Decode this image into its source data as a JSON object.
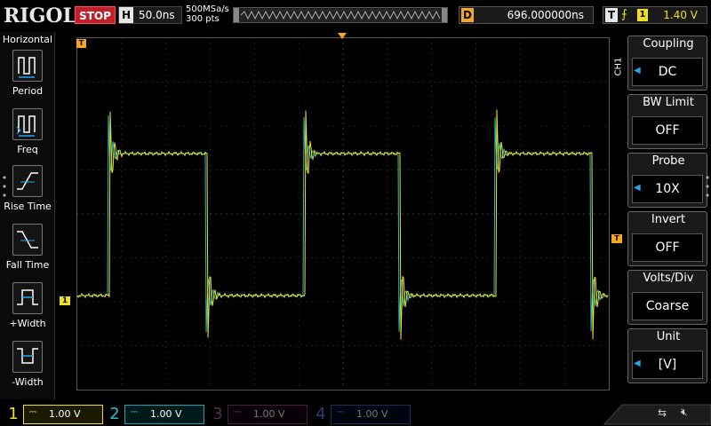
{
  "top": {
    "logo": "RIGOL",
    "run_state": "STOP",
    "h_label": "H",
    "timebase": "50.0ns",
    "sample_rate": "500MSa/s",
    "mem_depth": "300 pts",
    "delay_label": "D",
    "delay_value": "696.000000ns",
    "trig_label": "T",
    "trig_edge": "⨍",
    "trig_source": "1",
    "trig_level": "1.40 V"
  },
  "left": {
    "title": "Horizontal",
    "items": [
      {
        "label": "Period"
      },
      {
        "label": "Freq"
      },
      {
        "label": "Rise Time"
      },
      {
        "label": "Fall Time"
      },
      {
        "label": "+Width"
      },
      {
        "label": "-Width"
      }
    ]
  },
  "right": {
    "channel_tag": "CH1",
    "menu": [
      {
        "title": "Coupling",
        "value": "DC"
      },
      {
        "title": "BW Limit",
        "value": "OFF"
      },
      {
        "title": "Probe",
        "value": "10X"
      },
      {
        "title": "Invert",
        "value": "OFF"
      },
      {
        "title": "Volts/Div",
        "value": "Coarse"
      },
      {
        "title": "Unit",
        "value": "[V]"
      }
    ]
  },
  "channels": [
    {
      "num": "1",
      "scale": "1.00 V",
      "color": "#f0e020",
      "active": true
    },
    {
      "num": "2",
      "scale": "1.00 V",
      "color": "#20c0d0",
      "active": true
    },
    {
      "num": "3",
      "scale": "1.00 V",
      "color": "#a0207c",
      "active": false
    },
    {
      "num": "4",
      "scale": "1.00 V",
      "color": "#2a58b0",
      "active": false
    }
  ],
  "markers": {
    "ch1_ground": "1",
    "trigger_position": "T",
    "trigger_level": "T"
  },
  "colors": {
    "ch1": "#f0e020",
    "ch2": "#20c0d0",
    "trigger": "#f5a623",
    "accent": "#2aa4e8",
    "stop": "#c0202a"
  }
}
